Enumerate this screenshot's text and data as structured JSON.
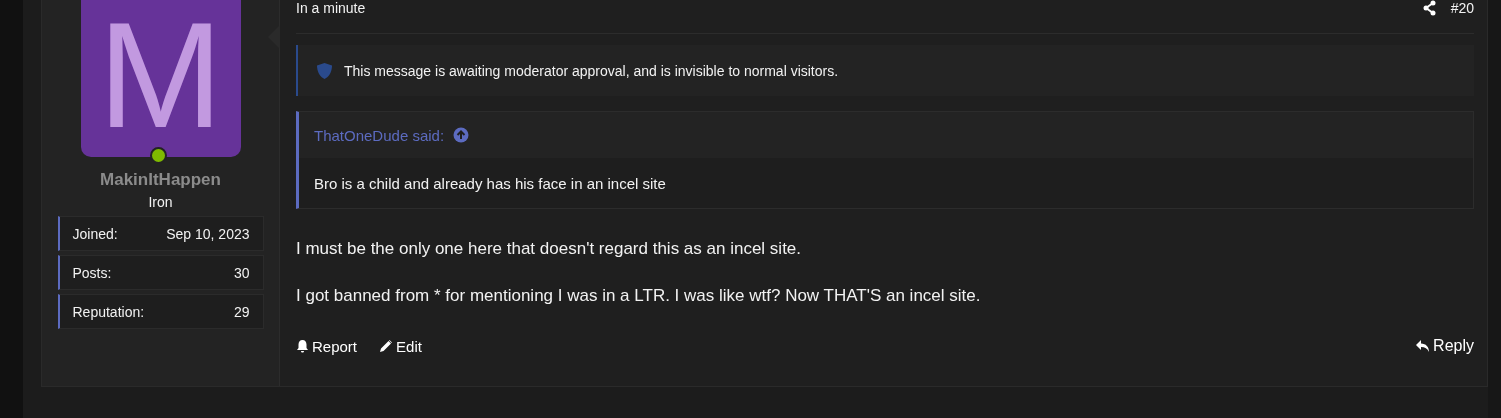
{
  "author": {
    "avatar_letter": "M",
    "online": true,
    "name": "MakinItHappen",
    "rank": "Iron",
    "stats": [
      {
        "label": "Joined:",
        "value": "Sep 10, 2023"
      },
      {
        "label": "Posts:",
        "value": "30"
      },
      {
        "label": "Reputation:",
        "value": "29"
      }
    ]
  },
  "post": {
    "time": "In a minute",
    "number": "#20",
    "notice": "This message is awaiting moderator approval, and is invisible to normal visitors.",
    "quote": {
      "author": "ThatOneDude said:",
      "text": "Bro is a child and already has his face in an incel site"
    },
    "paragraphs": [
      "I must be the only one here that doesn't regard this as an incel site.",
      "I got banned from * for mentioning I was in a LTR. I was like wtf? Now THAT'S an incel site."
    ],
    "actions": [
      "Report",
      "Edit"
    ],
    "reply": "Reply"
  }
}
